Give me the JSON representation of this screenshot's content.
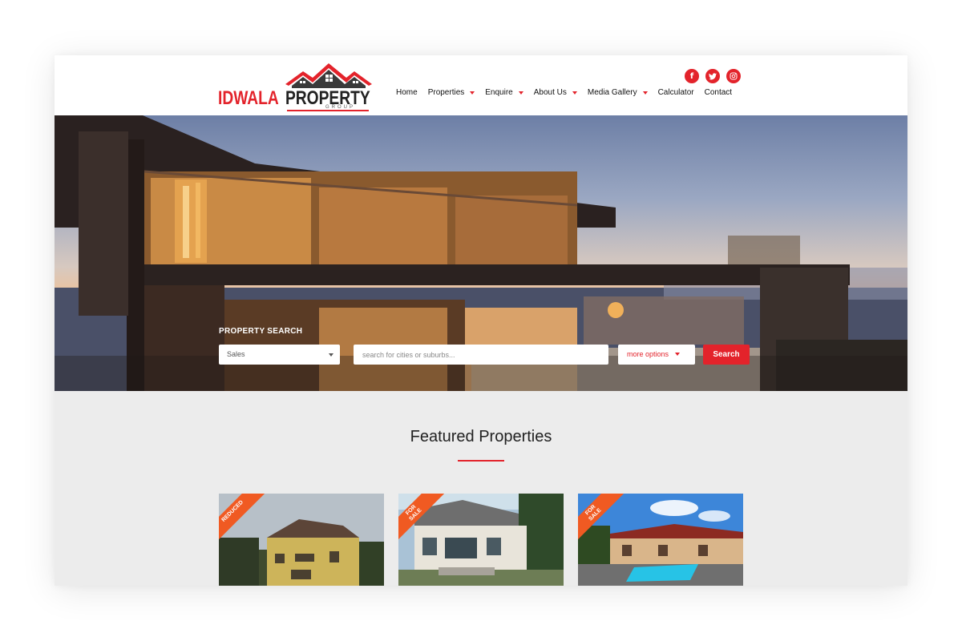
{
  "brand": {
    "word1": "IDWALA",
    "word2": "PROPERTY",
    "word3": "GROUP",
    "accent_color": "#e3232b"
  },
  "social": [
    {
      "icon": "facebook-icon",
      "glyph": "f"
    },
    {
      "icon": "twitter-icon",
      "glyph": "t"
    },
    {
      "icon": "instagram-icon",
      "glyph": "◎"
    }
  ],
  "nav": {
    "items": [
      {
        "label": "Home",
        "dropdown": false
      },
      {
        "label": "Properties",
        "dropdown": true
      },
      {
        "label": "Enquire",
        "dropdown": true
      },
      {
        "label": "About Us",
        "dropdown": true
      },
      {
        "label": "Media Gallery",
        "dropdown": true
      },
      {
        "label": "Calculator",
        "dropdown": false
      },
      {
        "label": "Contact",
        "dropdown": false
      }
    ]
  },
  "search": {
    "title": "PROPERTY SEARCH",
    "type_value": "Sales",
    "input_placeholder": "search for cities or suburbs...",
    "more_options_label": "more options",
    "button_label": "Search"
  },
  "featured": {
    "title": "Featured Properties",
    "cards": [
      {
        "badge_line1": "REDUCED",
        "badge_line2": ""
      },
      {
        "badge_line1": "FOR",
        "badge_line2": "SALE"
      },
      {
        "badge_line1": "FOR",
        "badge_line2": "SALE"
      }
    ]
  }
}
